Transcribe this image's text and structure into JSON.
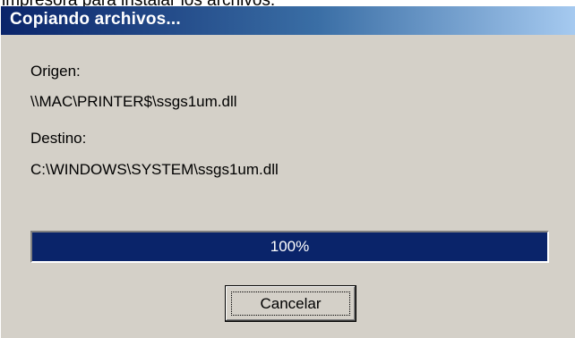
{
  "background_text": "impresora para instalar los  archivos.",
  "dialog": {
    "title": "Copiando archivos...",
    "source_label": "Origen:",
    "source_path": "\\\\MAC\\PRINTER$\\ssgs1um.dll",
    "destination_label": "Destino:",
    "destination_path": "C:\\WINDOWS\\SYSTEM\\ssgs1um.dll",
    "progress": {
      "value": 100,
      "text": "100%"
    },
    "cancel_label": "Cancelar"
  },
  "colors": {
    "titlebar_start": "#0a246a",
    "titlebar_end": "#a6caf0",
    "dialog_face": "#d4d0c8",
    "progress_fill": "#0a246a"
  }
}
